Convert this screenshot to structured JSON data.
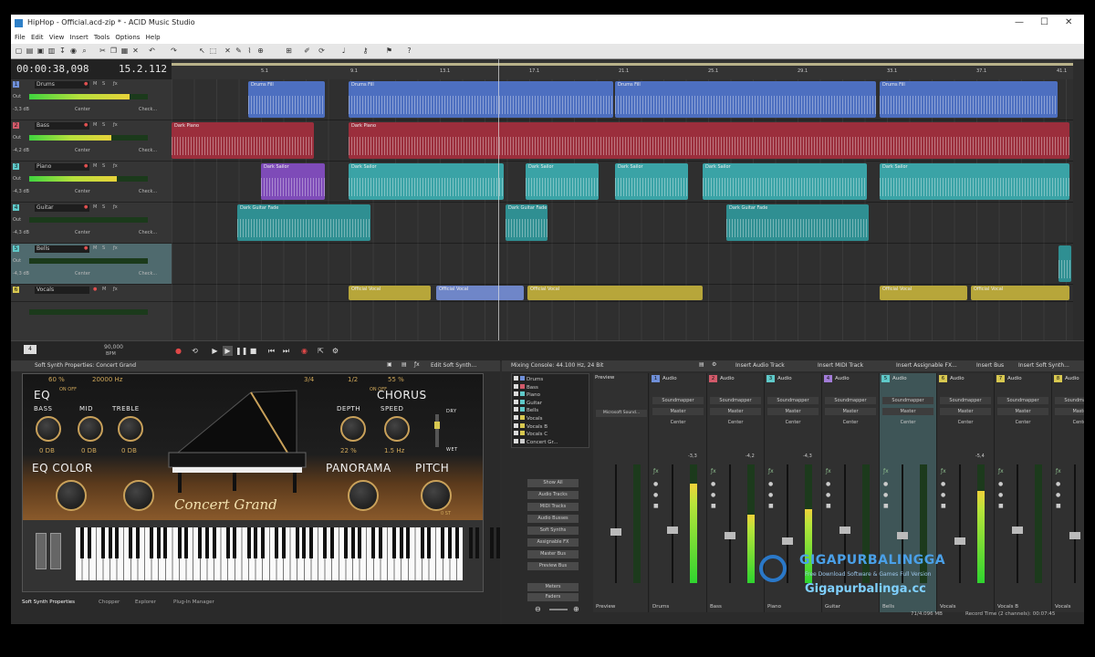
{
  "window": {
    "title": "HipHop - Official.acd-zip * - ACID Music Studio"
  },
  "menu": [
    "File",
    "Edit",
    "View",
    "Insert",
    "Tools",
    "Options",
    "Help"
  ],
  "timeline": {
    "time": "00:00:38,098",
    "position": "15.2.112",
    "ruler": [
      "5.1",
      "9.1",
      "13.1",
      "17.1",
      "21.1",
      "25.1",
      "29.1",
      "33.1",
      "37.1",
      "41.1"
    ],
    "tempo": {
      "value": "90,000",
      "unit": "BPM",
      "meter": "4"
    }
  },
  "tracks": [
    {
      "num": "1",
      "name": "Drums",
      "db": "-3,3 dB",
      "pan": "Center",
      "check": "Check...",
      "color": "#6f8fd8",
      "clip": "Drums Fill"
    },
    {
      "num": "2",
      "name": "Bass",
      "db": "-4,2 dB",
      "pan": "Center",
      "check": "Check...",
      "color": "#d25a6a",
      "clip": "Dark Piano"
    },
    {
      "num": "3",
      "name": "Piano",
      "db": "-4,3 dB",
      "pan": "Center",
      "check": "Check...",
      "color": "#5fc9c9",
      "clip": "Dark Sailor"
    },
    {
      "num": "4",
      "name": "Guitar",
      "db": "-4,3 dB",
      "pan": "Center",
      "check": "Check...",
      "color": "#5fc9c9",
      "clip": "Dark Guitar Fade"
    },
    {
      "num": "5",
      "name": "Bells",
      "db": "-4,3 dB",
      "pan": "Center",
      "check": "Check...",
      "color": "#5fc9c9",
      "clip": ""
    },
    {
      "num": "6",
      "name": "Vocals",
      "db": "",
      "pan": "",
      "check": "",
      "color": "#d8c850",
      "clip": "Official Vocal"
    }
  ],
  "io": {
    "out": "Out"
  },
  "synth": {
    "header": "Soft Synth Properties: Concert Grand",
    "edit_label": "Edit Soft Synth...",
    "top_values": [
      "60 %",
      "20000 Hz",
      "3/4",
      "1/2",
      "55 %"
    ],
    "eq": "EQ",
    "on_off": "ON OFF",
    "bass": "BASS",
    "mid": "MID",
    "treble": "TREBLE",
    "db_values": [
      "0 DB",
      "0 DB",
      "0 DB"
    ],
    "chorus": "CHORUS",
    "depth": "DEPTH",
    "speed": "SPEED",
    "depth_val": "22 %",
    "speed_val": "1.5 Hz",
    "dry": "DRY",
    "wet": "WET",
    "eq_color": "EQ COLOR",
    "panorama": "PANORAMA",
    "pitch": "PITCH",
    "brand": "Concert Grand",
    "pitch_unit": "0 ST",
    "tabs": [
      "Soft Synth Properties",
      "Chopper",
      "Explorer",
      "Plug-In Manager"
    ]
  },
  "mixer": {
    "header": "Mixing Console: 44.100 Hz, 24 Bit",
    "actions": [
      "Insert Audio Track",
      "Insert MIDI Track",
      "Insert Assignable FX...",
      "Insert Bus",
      "Insert Soft Synth..."
    ],
    "list": [
      {
        "name": "Drums",
        "color": "#6f8fd8"
      },
      {
        "name": "Bass",
        "color": "#d25a6a"
      },
      {
        "name": "Piano",
        "color": "#5fc9c9"
      },
      {
        "name": "Guitar",
        "color": "#5fc9c9"
      },
      {
        "name": "Bells",
        "color": "#5fc9c9"
      },
      {
        "name": "Vocals",
        "color": "#d8c850"
      },
      {
        "name": "Vocals B",
        "color": "#d8c850"
      },
      {
        "name": "Vocals C",
        "color": "#d8c850"
      },
      {
        "name": "Concert Gr...",
        "color": "#cccccc"
      }
    ],
    "buttons": [
      "Show All",
      "Audio Tracks",
      "MIDI Tracks",
      "Audio Busses",
      "Soft Synths",
      "Assignable FX",
      "Master Bus",
      "Preview Bus"
    ],
    "bottom_buttons": [
      "Meters",
      "Faders"
    ],
    "preview": {
      "name": "Preview",
      "device": "Microsoft Sound..."
    },
    "strips": [
      {
        "num": "1",
        "label": "Audio",
        "name": "Drums",
        "color": "#6f8fd8",
        "out": "Soundmapper",
        "bus": "Master",
        "pan": "Center",
        "level": 0.84,
        "db": "-3,3"
      },
      {
        "num": "2",
        "label": "Audio",
        "name": "Bass",
        "color": "#d25a6a",
        "out": "Soundmapper",
        "bus": "Master",
        "pan": "Center",
        "level": 0.58,
        "db": "-4,2"
      },
      {
        "num": "3",
        "label": "Audio",
        "name": "Piano",
        "color": "#5fc9c9",
        "out": "Soundmapper",
        "bus": "Master",
        "pan": "Center",
        "level": 0.62,
        "db": "-4,3"
      },
      {
        "num": "4",
        "label": "Audio",
        "name": "Guitar",
        "color": "#a27cd8",
        "out": "Soundmapper",
        "bus": "Master",
        "pan": "Center",
        "level": 0.0,
        "db": ""
      },
      {
        "num": "5",
        "label": "Audio",
        "name": "Bells",
        "color": "#5fc9c9",
        "out": "Soundmapper",
        "bus": "Master",
        "pan": "Center",
        "level": 0.0,
        "db": ""
      },
      {
        "num": "6",
        "label": "Audio",
        "name": "Vocals",
        "color": "#d8c850",
        "out": "Soundmapper",
        "bus": "Master",
        "pan": "Center",
        "level": 0.78,
        "db": "-5,4"
      },
      {
        "num": "7",
        "label": "Audio",
        "name": "Vocals B",
        "color": "#d8c850",
        "out": "Soundmapper",
        "bus": "Master",
        "pan": "Center",
        "level": 0.0,
        "db": ""
      },
      {
        "num": "8",
        "label": "Audio",
        "name": "Vocals",
        "color": "#d8c850",
        "out": "Soundmapper",
        "bus": "Master",
        "pan": "Center",
        "level": 0.0,
        "db": ""
      }
    ]
  },
  "status": {
    "memory": "71/4.096 MB",
    "record": "Record Time (2 channels):  00:07:45"
  },
  "watermark": {
    "brand": "GIGAPURBALINGGA",
    "tagline": "Free Download Software & Games Full Version",
    "url": "Gigapurbalinga.cc"
  }
}
